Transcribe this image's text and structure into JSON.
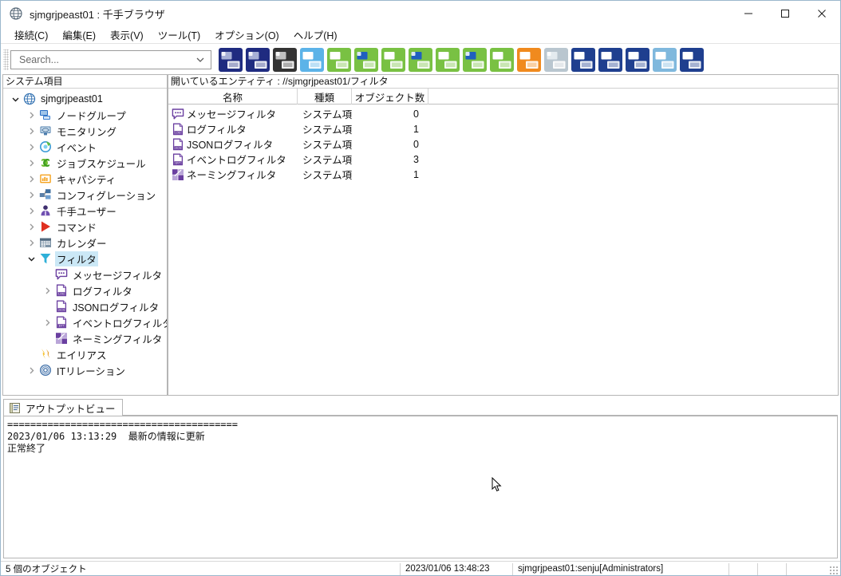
{
  "window": {
    "title": "sjmgrjpeast01 : 千手ブラウザ",
    "app_icon": "globe-icon",
    "minimize_label": "—",
    "maximize_label": "□",
    "close_label": "✕"
  },
  "menubar": {
    "items": [
      {
        "label": "接続(C)",
        "name": "menu-connect"
      },
      {
        "label": "編集(E)",
        "name": "menu-edit"
      },
      {
        "label": "表示(V)",
        "name": "menu-view"
      },
      {
        "label": "ツール(T)",
        "name": "menu-tools"
      },
      {
        "label": "オプション(O)",
        "name": "menu-options"
      },
      {
        "label": "ヘルプ(H)",
        "name": "menu-help"
      }
    ]
  },
  "toolbar": {
    "search": {
      "value": "",
      "placeholder": "Search..."
    },
    "icons": [
      {
        "name": "node-group-icon",
        "color": "#1f2b80",
        "accent": "#a7b0d6"
      },
      {
        "name": "node-icon",
        "color": "#1f2b80",
        "accent": "#a7b0d6"
      },
      {
        "name": "monitoring-icon",
        "color": "#333333",
        "accent": "#bfbfbf"
      },
      {
        "name": "message-filter-icon",
        "color": "#5cb3e8",
        "accent": "#ffffff"
      },
      {
        "name": "job-config-icon",
        "color": "#79c143",
        "accent": "#ffffff"
      },
      {
        "name": "job-check-icon",
        "color": "#79c143",
        "accent": "#1f5fbf"
      },
      {
        "name": "job-node-icon",
        "color": "#79c143",
        "accent": "#ffffff"
      },
      {
        "name": "job-monitor-check-icon",
        "color": "#79c143",
        "accent": "#1f5fbf"
      },
      {
        "name": "job-report-icon",
        "color": "#79c143",
        "accent": "#ffffff"
      },
      {
        "name": "capacity-chart-icon",
        "color": "#79c143",
        "accent": "#1f5fbf"
      },
      {
        "name": "log-list-icon",
        "color": "#79c143",
        "accent": "#ffffff"
      },
      {
        "name": "capacity-report-icon",
        "color": "#f08a1e",
        "accent": "#ffffff"
      },
      {
        "name": "disabled-node-icon",
        "color": "#b9c6cf",
        "accent": "#e4ebef"
      },
      {
        "name": "export-config-icon",
        "color": "#1f3f8f",
        "accent": "#ffffff"
      },
      {
        "name": "export-check-icon",
        "color": "#1f3f8f",
        "accent": "#ffffff"
      },
      {
        "name": "export-node-icon",
        "color": "#1f3f8f",
        "accent": "#ffffff"
      },
      {
        "name": "log-export-icon",
        "color": "#7fb8dd",
        "accent": "#ffffff"
      },
      {
        "name": "it-relation-icon",
        "color": "#1f3f8f",
        "accent": "#ffffff"
      }
    ]
  },
  "left_panel": {
    "header": "システム項目",
    "tree": [
      {
        "label": "sjmgrjpeast01",
        "depth": 0,
        "twisty": "down",
        "icon": "globe-icon",
        "selected": false
      },
      {
        "label": "ノードグループ",
        "depth": 1,
        "twisty": "right",
        "icon": "node-group-icon",
        "selected": false
      },
      {
        "label": "モニタリング",
        "depth": 1,
        "twisty": "right",
        "icon": "monitoring-icon",
        "selected": false
      },
      {
        "label": "イベント",
        "depth": 1,
        "twisty": "right",
        "icon": "event-icon",
        "selected": false
      },
      {
        "label": "ジョブスケジュール",
        "depth": 1,
        "twisty": "right",
        "icon": "job-schedule-icon",
        "selected": false
      },
      {
        "label": "キャパシティ",
        "depth": 1,
        "twisty": "right",
        "icon": "capacity-icon",
        "selected": false
      },
      {
        "label": "コンフィグレーション",
        "depth": 1,
        "twisty": "right",
        "icon": "configuration-icon",
        "selected": false
      },
      {
        "label": "千手ユーザー",
        "depth": 1,
        "twisty": "right",
        "icon": "user-icon",
        "selected": false
      },
      {
        "label": "コマンド",
        "depth": 1,
        "twisty": "right",
        "icon": "command-icon",
        "selected": false
      },
      {
        "label": "カレンダー",
        "depth": 1,
        "twisty": "right",
        "icon": "calendar-icon",
        "selected": false
      },
      {
        "label": "フィルタ",
        "depth": 1,
        "twisty": "down",
        "icon": "filter-icon",
        "selected": true
      },
      {
        "label": "メッセージフィルタ",
        "depth": 2,
        "twisty": "none",
        "icon": "message-filter-icon",
        "selected": false
      },
      {
        "label": "ログフィルタ",
        "depth": 2,
        "twisty": "right",
        "icon": "log-filter-icon",
        "selected": false
      },
      {
        "label": "JSONログフィルタ",
        "depth": 2,
        "twisty": "none",
        "icon": "json-log-filter-icon",
        "selected": false
      },
      {
        "label": "イベントログフィルタ",
        "depth": 2,
        "twisty": "right",
        "icon": "event-log-filter-icon",
        "selected": false
      },
      {
        "label": "ネーミングフィルタ",
        "depth": 2,
        "twisty": "none",
        "icon": "naming-filter-icon",
        "selected": false
      },
      {
        "label": "エイリアス",
        "depth": 1,
        "twisty": "none",
        "icon": "alias-icon",
        "selected": false
      },
      {
        "label": "ITリレーション",
        "depth": 1,
        "twisty": "right",
        "icon": "it-relation-icon",
        "selected": false
      }
    ]
  },
  "right_panel": {
    "entity_bar": "開いているエンティティ : //sjmgrjpeast01/フィルタ",
    "columns": [
      "名称",
      "種類",
      "オブジェクト数"
    ],
    "rows": [
      {
        "name": "メッセージフィルタ",
        "kind": "システム項...",
        "count": "0",
        "icon": "message-filter-icon"
      },
      {
        "name": "ログフィルタ",
        "kind": "システム項...",
        "count": "1",
        "icon": "log-filter-icon"
      },
      {
        "name": "JSONログフィルタ",
        "kind": "システム項...",
        "count": "0",
        "icon": "json-log-filter-icon"
      },
      {
        "name": "イベントログフィルタ",
        "kind": "システム項...",
        "count": "3",
        "icon": "event-log-filter-icon"
      },
      {
        "name": "ネーミングフィルタ",
        "kind": "システム項...",
        "count": "1",
        "icon": "naming-filter-icon"
      }
    ]
  },
  "output_view": {
    "tab_label": "アウトプットビュー",
    "tab_icon": "output-view-icon",
    "lines": [
      "========================================",
      "2023/01/06 13:13:29  最新の情報に更新",
      "正常終了"
    ]
  },
  "statusbar": {
    "object_count": "5 個のオブジェクト",
    "timestamp": "2023/01/06 13:48:23",
    "user": "sjmgrjpeast01:senju[Administrators]",
    "extra1": "",
    "extra2": "",
    "extra3": ""
  },
  "colors": {
    "accent": "#1f3f8f",
    "selection": "#cbe8f6",
    "filter_purple": "#6a3fa0",
    "green": "#79c143",
    "orange": "#f08a1e"
  }
}
